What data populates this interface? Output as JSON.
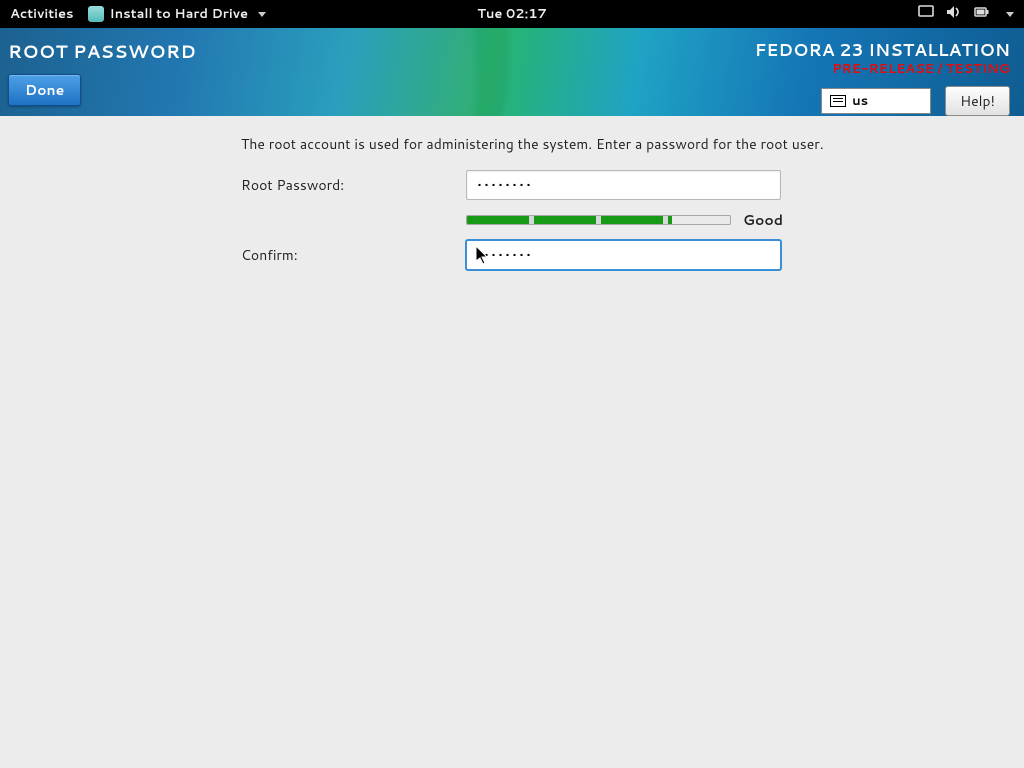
{
  "topbar": {
    "activities": "Activities",
    "app_name": "Install to Hard Drive",
    "clock": "Tue 02:17"
  },
  "header": {
    "page_title": "ROOT PASSWORD",
    "done": "Done",
    "install_title": "FEDORA 23 INSTALLATION",
    "prerelease": "PRE-RELEASE / TESTING",
    "kb_layout": "us",
    "help": "Help!"
  },
  "form": {
    "intro": "The root account is used for administering the system.  Enter a password for the root user.",
    "root_label": "Root Password:",
    "root_value": "••••••••",
    "strength_label": "Good",
    "confirm_label": "Confirm:",
    "confirm_value": "••••••••"
  }
}
